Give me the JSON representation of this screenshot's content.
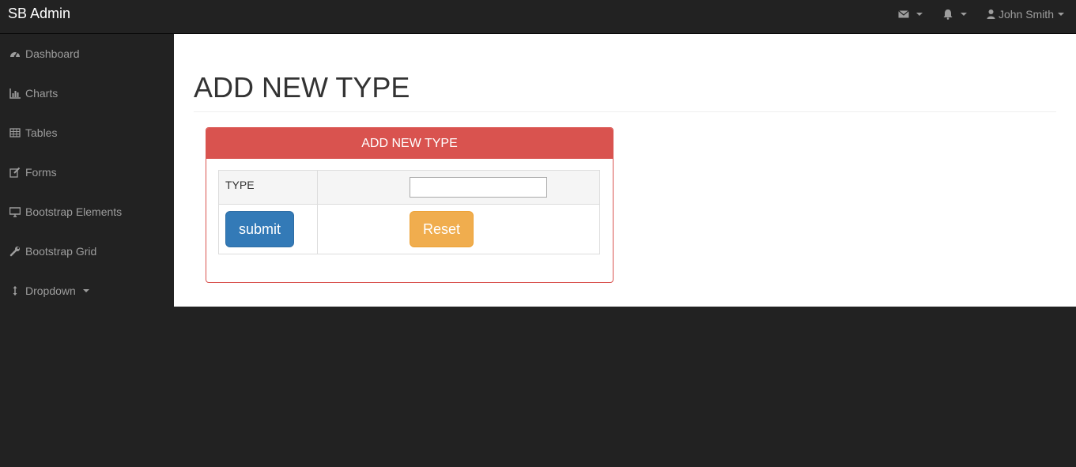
{
  "navbar": {
    "brand": "SB Admin",
    "messages_icon": "envelope-icon",
    "alerts_icon": "bell-icon",
    "user_icon": "user-icon",
    "user_name": "John Smith"
  },
  "sidebar": {
    "items": [
      {
        "label": "Dashboard",
        "icon": "dashboard-icon"
      },
      {
        "label": "Charts",
        "icon": "bar-chart-icon"
      },
      {
        "label": "Tables",
        "icon": "table-icon"
      },
      {
        "label": "Forms",
        "icon": "edit-icon"
      },
      {
        "label": "Bootstrap Elements",
        "icon": "desktop-icon"
      },
      {
        "label": "Bootstrap Grid",
        "icon": "wrench-icon"
      },
      {
        "label": "Dropdown",
        "icon": "arrows-v-icon"
      }
    ]
  },
  "main": {
    "page_title": "ADD NEW TYPE",
    "panel": {
      "heading": "ADD NEW TYPE",
      "type_label": "TYPE",
      "type_value": "",
      "submit_label": "submit",
      "reset_label": "Reset"
    }
  },
  "colors": {
    "navbar_bg": "#222222",
    "danger": "#d9534f",
    "primary": "#337ab7",
    "warning": "#f0ad4e"
  }
}
